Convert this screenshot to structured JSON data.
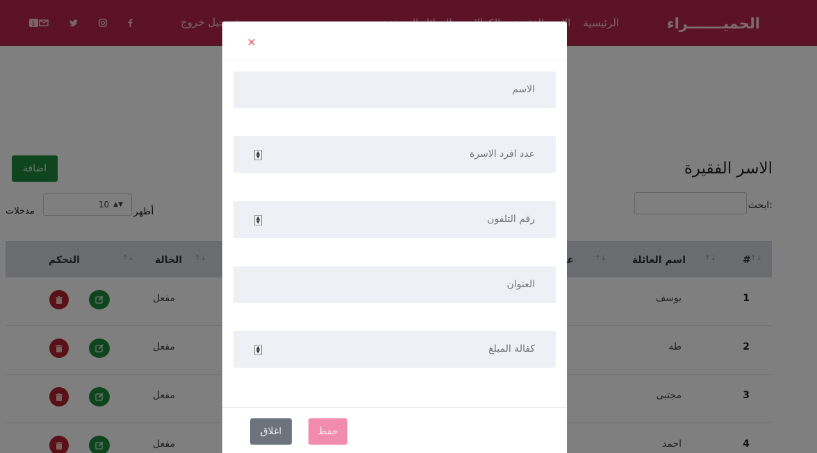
{
  "navbar": {
    "brand": "الحميـــــــراء",
    "links": [
      "الرئيسية",
      "الاسر الفقيرة",
      "الكفالات",
      "العوائل المتعففة",
      "الاحصائيات"
    ],
    "logout": "تسجيل خروج",
    "icons": [
      "youtube-icon",
      "twitter-icon",
      "instagram-icon",
      "facebook-icon"
    ],
    "color": "#b6244e"
  },
  "page": {
    "title": "الاسر الفقيرة",
    "add_button": "اضافة",
    "search_label": "ابحث:",
    "show_label": "أظهر",
    "entries_label": "مدخلات",
    "length_value": "10"
  },
  "table": {
    "headers": {
      "num": "#",
      "name": "اسم العائلة",
      "count": "عدد",
      "status": "الحالة",
      "control": "التحكم"
    },
    "rows": [
      {
        "num": "1",
        "name": "يوسف",
        "status": "مفعل"
      },
      {
        "num": "2",
        "name": "طه",
        "status": "مفعل"
      },
      {
        "num": "3",
        "name": "مجتبى",
        "status": "مفعل"
      },
      {
        "num": "4",
        "name": "احمد",
        "status": "مفعل"
      }
    ]
  },
  "modal": {
    "close_symbol": "×",
    "fields": [
      {
        "placeholder": "الاسم",
        "type": "text"
      },
      {
        "placeholder": "عدد افرد الاسرة",
        "type": "number"
      },
      {
        "placeholder": "رقم التلفون",
        "type": "number"
      },
      {
        "placeholder": "العنوان",
        "type": "text"
      },
      {
        "placeholder": "كفالة المبلغ",
        "type": "number"
      }
    ],
    "save_label": "حفظ",
    "close_label": "اغلاق"
  },
  "colors": {
    "accent": "#b6244e",
    "success": "#1e8a3b",
    "danger": "#b3202f",
    "save": "#f28cae",
    "secondary": "#6c757d"
  }
}
